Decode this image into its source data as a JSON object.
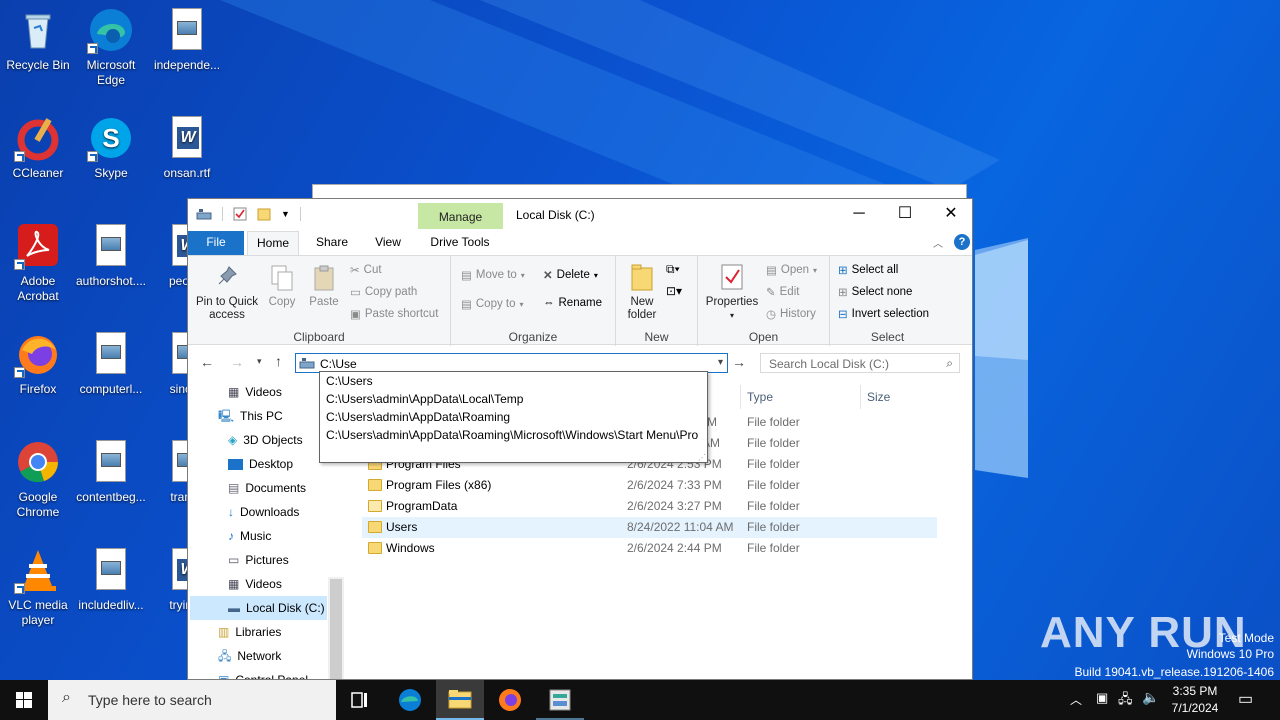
{
  "desktop": {
    "icons": [
      {
        "label": "Recycle Bin"
      },
      {
        "label": "Microsoft Edge"
      },
      {
        "label": "independe..."
      },
      {
        "label": "CCleaner"
      },
      {
        "label": "Skype"
      },
      {
        "label": "onsan.rtf"
      },
      {
        "label": "Adobe Acrobat"
      },
      {
        "label": "authorshot...."
      },
      {
        "label": "people"
      },
      {
        "label": "Firefox"
      },
      {
        "label": "computerl..."
      },
      {
        "label": "sinceu"
      },
      {
        "label": "Google Chrome"
      },
      {
        "label": "contentbeg..."
      },
      {
        "label": "transp"
      },
      {
        "label": "VLC media player"
      },
      {
        "label": "includedliv..."
      },
      {
        "label": "tryings"
      }
    ]
  },
  "explorer": {
    "title": "Local Disk (C:)",
    "context_tab": "Manage",
    "tabs": {
      "file": "File",
      "home": "Home",
      "share": "Share",
      "view": "View",
      "drive_tools": "Drive Tools"
    },
    "ribbon": {
      "clipboard": {
        "label": "Clipboard",
        "pin": "Pin to Quick access",
        "copy": "Copy",
        "paste": "Paste",
        "cut": "Cut",
        "copy_path": "Copy path",
        "paste_shortcut": "Paste shortcut"
      },
      "organize": {
        "label": "Organize",
        "move_to": "Move to",
        "copy_to": "Copy to",
        "delete": "Delete",
        "rename": "Rename"
      },
      "new": {
        "label": "New",
        "new_folder": "New folder"
      },
      "open": {
        "label": "Open",
        "properties": "Properties",
        "open": "Open",
        "edit": "Edit",
        "history": "History"
      },
      "select": {
        "label": "Select",
        "select_all": "Select all",
        "select_none": "Select none",
        "invert": "Invert selection"
      }
    },
    "address_value": "C:\\Use",
    "search_placeholder": "Search Local Disk (C:)",
    "suggestions": [
      "C:\\Users",
      "C:\\Users\\admin\\AppData\\Local\\Temp",
      "C:\\Users\\admin\\AppData\\Roaming",
      "C:\\Users\\admin\\AppData\\Roaming\\Microsoft\\Windows\\Start Menu\\Pro"
    ],
    "nav": {
      "videos_top": "Videos",
      "this_pc": "This PC",
      "objects3d": "3D Objects",
      "desktop": "Desktop",
      "documents": "Documents",
      "downloads": "Downloads",
      "music": "Music",
      "pictures": "Pictures",
      "videos": "Videos",
      "local_disk": "Local Disk (C:)",
      "libraries": "Libraries",
      "network": "Network",
      "control_panel": "Control Panel"
    },
    "columns": {
      "type": "Type",
      "size": "Size"
    },
    "partial_rows": [
      {
        "date_tail": "M",
        "type": "File folder"
      },
      {
        "date_tail": "AM",
        "type": "File folder"
      }
    ],
    "files": [
      {
        "name": "Program Files",
        "date": "2/6/2024 2:53 PM",
        "type": "File folder"
      },
      {
        "name": "Program Files (x86)",
        "date": "2/6/2024 7:33 PM",
        "type": "File folder"
      },
      {
        "name": "ProgramData",
        "date": "2/6/2024 3:27 PM",
        "type": "File folder"
      },
      {
        "name": "Users",
        "date": "8/24/2022 11:04 AM",
        "type": "File folder"
      },
      {
        "name": "Windows",
        "date": "2/6/2024 2:44 PM",
        "type": "File folder"
      }
    ]
  },
  "taskbar": {
    "search_placeholder": "Type here to search",
    "time": "3:35 PM",
    "date": "7/1/2024"
  },
  "watermark": {
    "brand": "ANY RUN",
    "line1": "Test Mode",
    "line2": "Windows 10 Pro",
    "line3": "Build 19041.vb_release.191206-1406"
  },
  "colors": {
    "accent": "#1a73c8",
    "manage_tab": "#c7e8a4",
    "desktop_blue": "#0a52d0",
    "selected_row": "#e5f3ff"
  }
}
